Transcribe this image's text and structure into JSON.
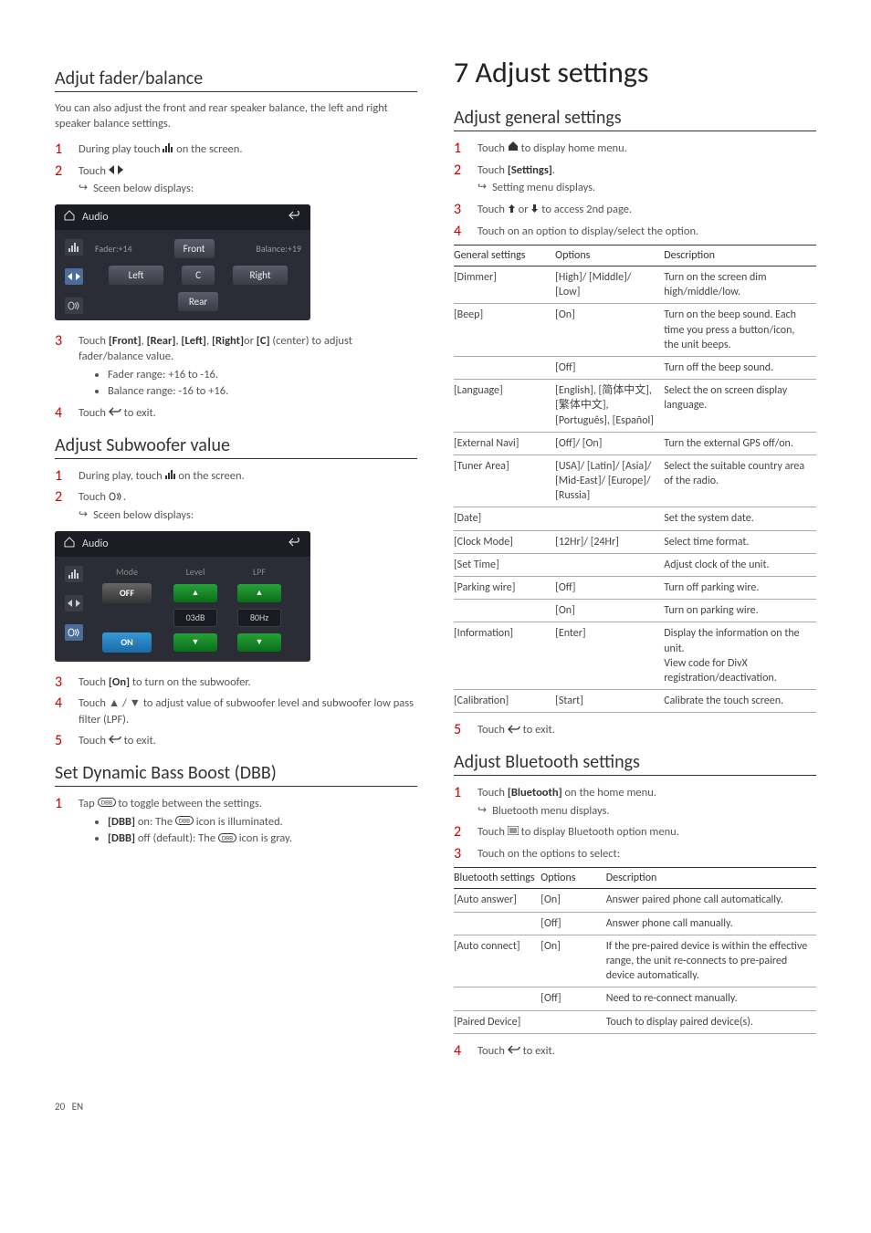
{
  "footer": {
    "page": "20",
    "lang": "EN"
  },
  "left": {
    "fader": {
      "heading": "Adjut fader/balance",
      "intro": "You can also adjust the front and rear speaker balance, the left and right speaker balance settings.",
      "step1": "During play touch",
      "step1_suffix": "on the screen.",
      "step2": "Touch",
      "step2_result": "Sceen below displays:",
      "step3_a": "Touch ",
      "step3_front": "[Front]",
      "step3_rear": "[Rear]",
      "step3_left": "[Left]",
      "step3_right": "[Right]",
      "step3_or": "or ",
      "step3_c": "[C]",
      "step3_b": " (center) to adjust fader/balance value.",
      "bullet1": "Fader range: +16 to -16.",
      "bullet2": "Balance range: -16 to +16.",
      "step4": "Touch ",
      "step4_suffix": " to exit.",
      "ss": {
        "title": "Audio",
        "fader_label": "Fader:+14",
        "balance_label": "Balance:+19",
        "front": "Front",
        "left": "Left",
        "center": "C",
        "right": "Right",
        "rear": "Rear"
      }
    },
    "sub": {
      "heading": "Adjust Subwoofer value",
      "step1": "During play, touch",
      "step1_suffix": "on the screen.",
      "step2": "Touch",
      "step2_result": "Sceen below displays:",
      "step3_a": "Touch ",
      "step3_on": "[On]",
      "step3_b": " to turn on the subwoofer.",
      "step4": "Touch ▲ / ▼ to adjust value of subwoofer level and subwoofer low pass filter (LPF).",
      "step5": "Touch ",
      "step5_suffix": " to exit.",
      "ss": {
        "title": "Audio",
        "mode": "Mode",
        "level": "Level",
        "lpf": "LPF",
        "off": "OFF",
        "on": "ON",
        "level_val": "03dB",
        "lpf_val": "80Hz"
      }
    },
    "dbb": {
      "heading": "Set Dynamic Bass Boost (DBB)",
      "step1": "Tap ",
      "step1_suffix": " to toggle between the settings.",
      "bullet1_a": "[DBB]",
      "bullet1_b": " on: The ",
      "bullet1_c": " icon is illuminated.",
      "bullet2_a": "[DBB]",
      "bullet2_b": " off (default): The ",
      "bullet2_c": " icon is gray."
    }
  },
  "right": {
    "title": "7   Adjust settings",
    "general": {
      "heading": "Adjust general settings",
      "step1": "Touch ",
      "step1_suffix": " to display home menu.",
      "step2": "Touch ",
      "step2_b": "[Settings]",
      "step2_c": ".",
      "step2_result": "Setting menu displays.",
      "step3": "Touch ",
      "step3_suffix": " to access 2nd page.",
      "step4": "Touch on an option to display/select the option.",
      "th1": "General settings",
      "th2": "Options",
      "th3": "Description",
      "rows": [
        {
          "s": "[Dimmer]",
          "o": "[High]/ [Middle]/ [Low]",
          "d": "Turn on the screen dim high/middle/low."
        },
        {
          "s": "[Beep]",
          "o": "[On]",
          "d": "Turn on the beep sound. Each time you press a button/icon, the unit beeps."
        },
        {
          "s": "",
          "o": "[Off]",
          "d": "Turn off the beep sound."
        },
        {
          "s": "[Language]",
          "o": "[English], [简体中文], [繁体中文], [Português], [Español]",
          "d": "Select the on screen display language."
        },
        {
          "s": "[External Navi]",
          "o": "[Off]/ [On]",
          "d": "Turn the external GPS off/on."
        },
        {
          "s": "[Tuner Area]",
          "o": "[USA]/ [Latin]/ [Asia]/ [Mid-East]/ [Europe]/ [Russia]",
          "d": "Select the suitable country area of the radio."
        },
        {
          "s": "[Date]",
          "o": "",
          "d": "Set the system date."
        },
        {
          "s": "[Clock Mode]",
          "o": "[12Hr]/ [24Hr]",
          "d": "Select time format."
        },
        {
          "s": "[Set Time]",
          "o": "",
          "d": "Adjust clock of the unit."
        },
        {
          "s": "[Parking wire]",
          "o": "[Off]",
          "d": "Turn off parking wire."
        },
        {
          "s": "",
          "o": "[On]",
          "d": "Turn on parking wire."
        },
        {
          "s": "[Information]",
          "o": "[Enter]",
          "d": "Display the information on the unit.\nView code for DivX registration/deactivation."
        },
        {
          "s": "[Calibration]",
          "o": "[Start]",
          "d": "Calibrate the touch screen."
        }
      ],
      "step5": "Touch ",
      "step5_suffix": " to exit."
    },
    "bt": {
      "heading": "Adjust Bluetooth settings",
      "step1": "Touch ",
      "step1_b": "[Bluetooth]",
      "step1_c": " on the home menu.",
      "step1_result": "Bluetooth menu displays.",
      "step2": "Touch ",
      "step2_suffix": " to display Bluetooth option menu.",
      "step3": "Touch on the options to select:",
      "th1": "Bluetooth settings",
      "th2": "Options",
      "th3": "Description",
      "rows": [
        {
          "s": "[Auto answer]",
          "o": "[On]",
          "d": "Answer paired phone call automatically."
        },
        {
          "s": "",
          "o": "[Off]",
          "d": "Answer phone call manually."
        },
        {
          "s": "[Auto connect]",
          "o": "[On]",
          "d": "If the pre-paired device is within the effective range, the unit re-connects to pre-paired device automatically."
        },
        {
          "s": "",
          "o": "[Off]",
          "d": "Need to re-connect manually."
        },
        {
          "s": "[Paired Device]",
          "o": "",
          "d": "Touch to display paired device(s)."
        }
      ],
      "step4": "Touch ",
      "step4_suffix": " to exit."
    }
  }
}
